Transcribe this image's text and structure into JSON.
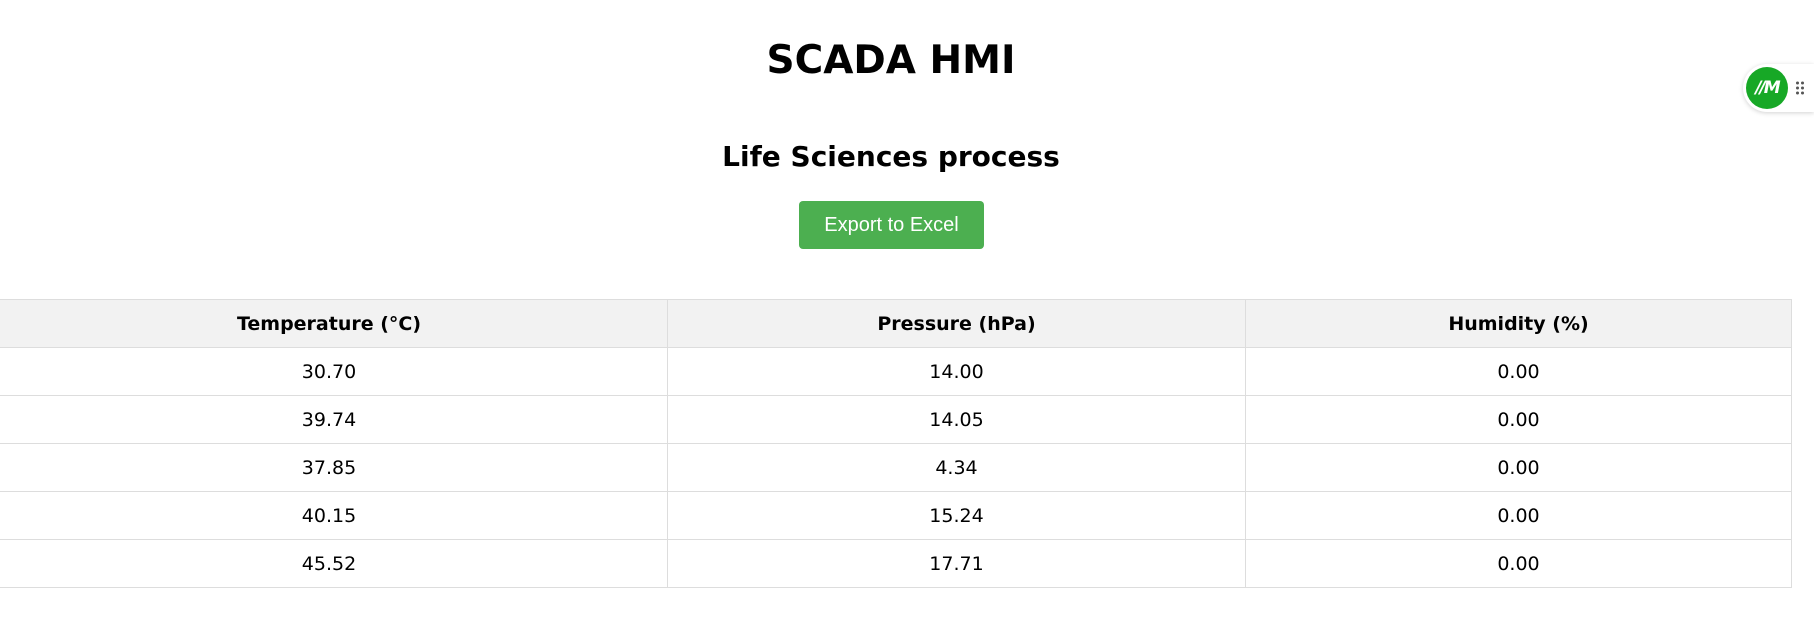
{
  "header": {
    "title": "SCADA HMI",
    "subtitle": "Life Sciences process"
  },
  "actions": {
    "export_label": "Export to Excel"
  },
  "table": {
    "columns": [
      "Temperature (°C)",
      "Pressure (hPa)",
      "Humidity (%)"
    ],
    "rows": [
      [
        "30.70",
        "14.00",
        "0.00"
      ],
      [
        "39.74",
        "14.05",
        "0.00"
      ],
      [
        "37.85",
        "4.34",
        "0.00"
      ],
      [
        "40.15",
        "15.24",
        "0.00"
      ],
      [
        "45.52",
        "17.71",
        "0.00"
      ]
    ]
  },
  "widget": {
    "logo_text": "//M",
    "logo_color": "#17a826",
    "grip_icon": "drag-handle-icon"
  },
  "colors": {
    "button_bg": "#4caf50",
    "header_bg": "#f2f2f2",
    "border": "#dddddd"
  }
}
